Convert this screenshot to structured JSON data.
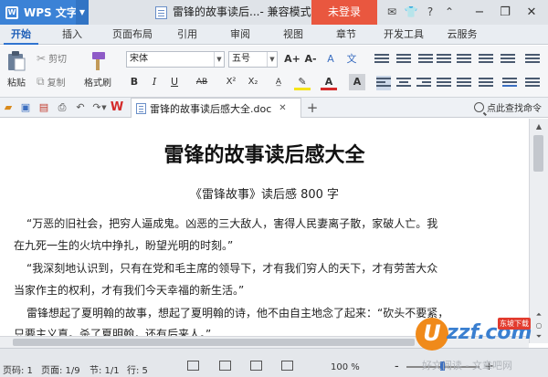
{
  "app": {
    "name": "WPS 文字",
    "login_label": "未登录"
  },
  "window": {
    "title": "雷锋的故事读后...",
    "mode": " - 兼容模式"
  },
  "menu": {
    "tabs": [
      "开始",
      "插入",
      "页面布局",
      "引用",
      "审阅",
      "视图",
      "章节",
      "开发工具",
      "云服务"
    ]
  },
  "ribbon": {
    "paste_label": "粘贴",
    "cut_label": "剪切",
    "copy_label": "复制",
    "format_painter_label": "格式刷",
    "font_name": "宋体",
    "font_size": "五号",
    "bold": "B",
    "italic": "I",
    "underline": "U",
    "strikethrough": "AB",
    "superscript": "X²",
    "subscript": "X₂",
    "grow_font": "A+",
    "shrink_font": "A-",
    "clear_format": "A",
    "font_color": "A",
    "char_shading": "A"
  },
  "tabbar": {
    "doc_tab_label": "雷锋的故事读后感大全.doc",
    "search_label": "点此查找命令"
  },
  "document": {
    "title": "雷锋的故事读后感大全",
    "subtitle": "《雷锋故事》读后感 800 字",
    "lines": [
      "“万恶的旧社会，把穷人逼成鬼。凶恶的三大敌人，害得人民妻离子散，家破人亡。我",
      "在九死一生的火坑中挣扎，盼望光明的时刻。”",
      "“我深刻地认识到，只有在党和毛主席的领导下，才有我们穷人的天下，才有劳苦大众",
      "当家作主的权利，才有我们今天幸福的新生活。”",
      "雷锋想起了夏明翰的故事，想起了夏明翰的诗，他不由自主地念了起来：“砍头不要紧，",
      "只要主义真。杀了夏明翰，还有后来人。”"
    ]
  },
  "status": {
    "page_no": "页码: 1",
    "pages": "页面: 1/9",
    "section": "节: 1/1",
    "line": "行: 5",
    "zoom": "100 %",
    "zoom_minus": "-",
    "zoom_plus": "+"
  },
  "watermark": {
    "logo_u": "U",
    "brand": "zzf.com",
    "badge": "东坡下载",
    "text": "好文阅读 - 文章吧网"
  },
  "colors": {
    "wps_blue": "#3b82d6",
    "login_red": "#e9573f",
    "active_tab": "#1f5fb8"
  }
}
